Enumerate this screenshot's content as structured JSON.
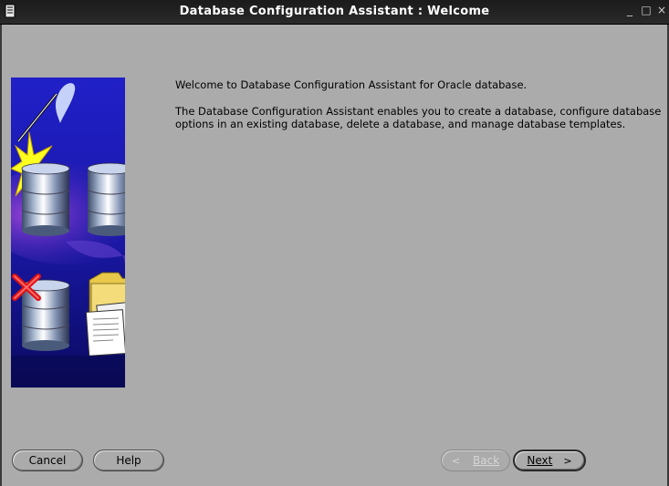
{
  "window": {
    "title": "Database Configuration Assistant : Welcome",
    "minimize_glyph": "_",
    "maximize_glyph": "□",
    "close_glyph": "×"
  },
  "content": {
    "welcome_line": "Welcome to Database Configuration Assistant for Oracle database.",
    "description": "The Database Configuration Assistant enables you to create a database, configure database options in an existing database, delete a database, and manage database templates."
  },
  "buttons": {
    "cancel": "Cancel",
    "help": "Help",
    "back": "Back",
    "back_arrow": "<",
    "next": "Next",
    "next_arrow": ">"
  },
  "colors": {
    "window_bg": "#ababab",
    "titlebar": "#1b1b1b",
    "illustration_bg": "#1a1a9a",
    "checkmark": "#d01010"
  },
  "icons": [
    "system-menu-icon",
    "minimize-icon",
    "maximize-icon",
    "close-icon",
    "magic-wand-icon",
    "database-icon",
    "checkbox-icon",
    "delete-x-icon",
    "folder-icon",
    "documents-icon"
  ]
}
